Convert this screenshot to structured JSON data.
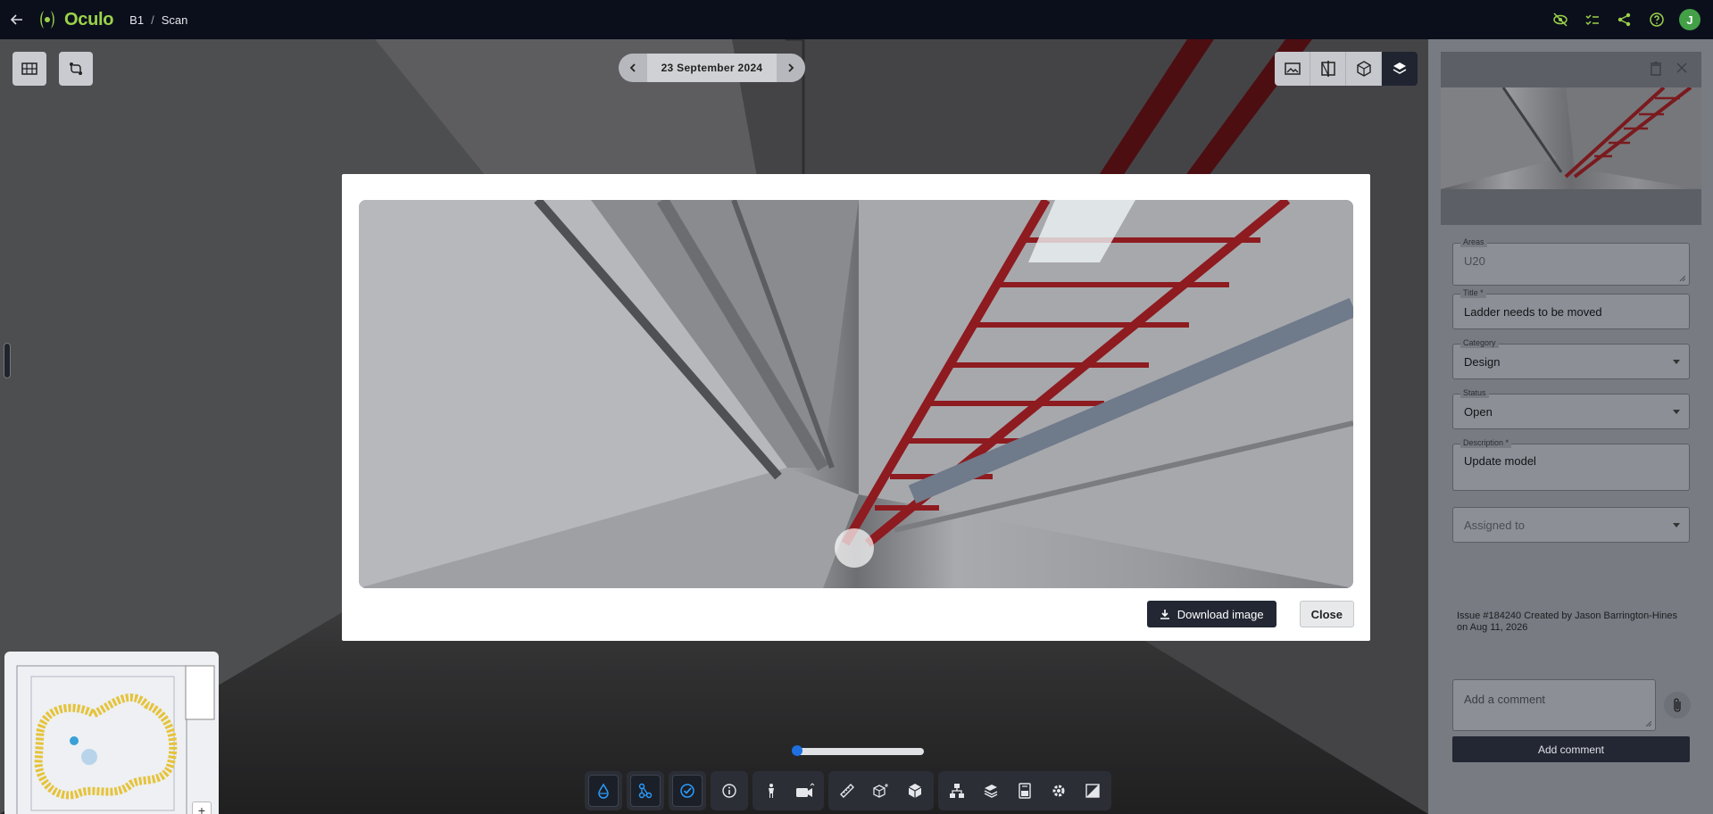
{
  "app": {
    "name": "Oculo",
    "accent": "#9bd24a"
  },
  "breadcrumb": [
    "B1",
    "Scan"
  ],
  "user": {
    "initial": "J",
    "color": "#43a047"
  },
  "date_nav": {
    "label": "23 September 2024"
  },
  "modal": {
    "download_label": "Download image",
    "close_label": "Close"
  },
  "issue": {
    "areas": {
      "label": "Areas",
      "value": "U20"
    },
    "title": {
      "label": "Title *",
      "value": "Ladder needs to be moved"
    },
    "category": {
      "label": "Category",
      "value": "Design"
    },
    "status": {
      "label": "Status",
      "value": "Open"
    },
    "description": {
      "label": "Description *",
      "value": "Update model"
    },
    "assigned": {
      "placeholder": "Assigned to"
    },
    "meta": "Issue #184240 Created by Jason Barrington-Hines on Aug 11, 2026",
    "comment_placeholder": "Add a comment",
    "add_comment_label": "Add comment"
  },
  "icons": {
    "topbar": [
      "visibility-off-icon",
      "checklist-icon",
      "share-icon",
      "help-icon"
    ],
    "view_modes": [
      "image-icon",
      "split-view-icon",
      "model-icon",
      "layers-icon"
    ],
    "bottom_toolbar": [
      "water-drop-icon",
      "nodes-icon",
      "check-circle-icon",
      "info-icon",
      "person-icon",
      "camera-icon",
      "ruler-icon",
      "box-add-icon",
      "cube-icon",
      "hierarchy-icon",
      "stack-icon",
      "document-icon",
      "settings-icon",
      "compare-icon"
    ]
  },
  "minimap": {
    "zoom_in": "+",
    "zoom_out": "−"
  }
}
